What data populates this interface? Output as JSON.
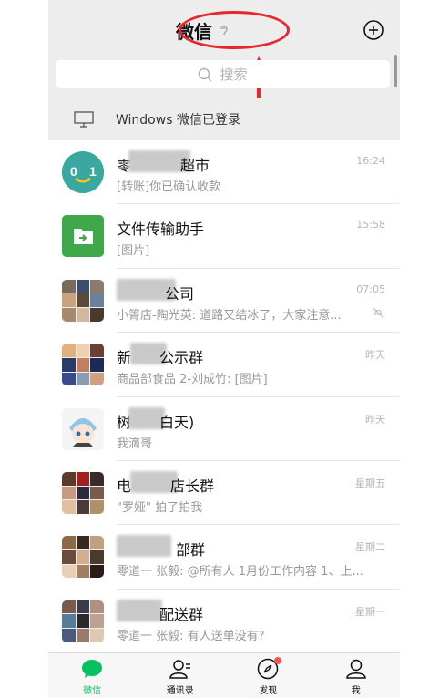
{
  "header": {
    "title": "微信",
    "plus_icon": "plus-circle-icon",
    "ear_icon": "ear-icon"
  },
  "search": {
    "placeholder": "搜索"
  },
  "login_bar": {
    "text": "Windows 微信已登录",
    "icon": "monitor-icon"
  },
  "chats": [
    {
      "name": "零",
      "name_tail": "超市",
      "message": "[转账]你已确认收款",
      "time": "16:24",
      "avatar": "zero-one-logo"
    },
    {
      "name": "文件传输助手",
      "name_tail": "",
      "message": "[图片]",
      "time": "15:58",
      "avatar": "file-transfer-icon"
    },
    {
      "name": "",
      "name_tail": "公司",
      "message": "小箐店-陶光英: 道路又结冰了，大家注意...",
      "time": "07:05",
      "avatar": "group-grid",
      "muted": true
    },
    {
      "name": "新",
      "name_tail": "公示群",
      "message": "商品部食品 2-刘成竹: [图片]",
      "time": "昨天",
      "avatar": "group-grid"
    },
    {
      "name": "树",
      "name_tail": "白天)",
      "message": "我滴哥",
      "time": "昨天",
      "avatar": "anime-avatar"
    },
    {
      "name": "电",
      "name_tail": "店长群",
      "message": "\"罗娅\" 拍了拍我",
      "time": "星期五",
      "avatar": "group-grid"
    },
    {
      "name": "",
      "name_tail": "部群",
      "message": "零道一 张毅: @所有人  1月份工作内容 1、上...",
      "time": "星期二",
      "avatar": "group-grid"
    },
    {
      "name": "",
      "name_tail": "配送群",
      "message": "零道一 张毅: 有人送单没有?",
      "time": "星期一",
      "avatar": "group-grid"
    }
  ],
  "tabs": [
    {
      "label": "微信",
      "icon": "chat-bubble-icon",
      "active": true
    },
    {
      "label": "通讯录",
      "icon": "contacts-icon"
    },
    {
      "label": "发现",
      "icon": "compass-icon",
      "badge": true
    },
    {
      "label": "我",
      "icon": "person-icon"
    }
  ],
  "colors": {
    "accent": "#07c160",
    "annotation_red": "#e8262b",
    "badge": "#fa5151"
  }
}
